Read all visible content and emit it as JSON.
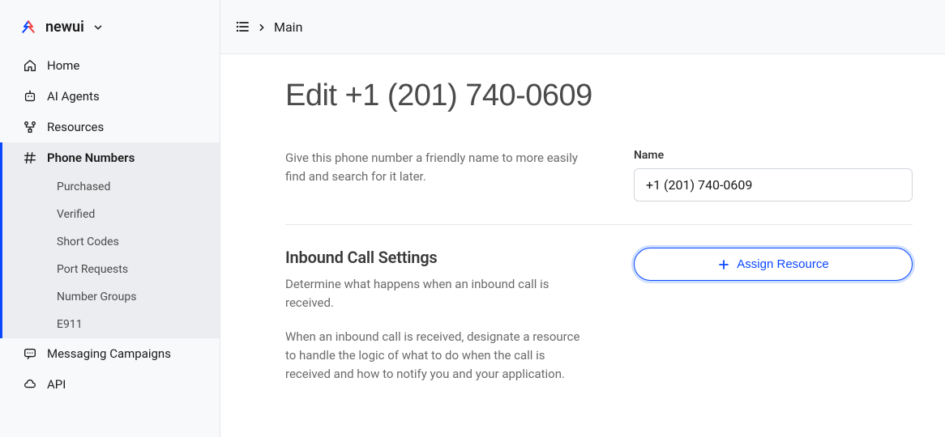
{
  "workspace": {
    "name": "newui"
  },
  "nav": {
    "items": [
      {
        "label": "Home",
        "icon": "home"
      },
      {
        "label": "AI Agents",
        "icon": "robot"
      },
      {
        "label": "Resources",
        "icon": "flow"
      },
      {
        "label": "Phone Numbers",
        "icon": "hash",
        "active": true,
        "children": [
          {
            "label": "Purchased"
          },
          {
            "label": "Verified"
          },
          {
            "label": "Short Codes"
          },
          {
            "label": "Port Requests"
          },
          {
            "label": "Number Groups"
          },
          {
            "label": "E911"
          }
        ]
      },
      {
        "label": "Messaging Campaigns",
        "icon": "message"
      },
      {
        "label": "API",
        "icon": "cloud"
      }
    ]
  },
  "breadcrumb": {
    "label": "Main"
  },
  "page": {
    "title": "Edit +1 (201) 740-0609"
  },
  "name_section": {
    "desc": "Give this phone number a friendly name to more easily find and search for it later.",
    "label": "Name",
    "value": "+1 (201) 740-0609"
  },
  "inbound_section": {
    "title": "Inbound Call Settings",
    "desc1": "Determine what happens when an inbound call is received.",
    "desc2": "When an inbound call is received, designate a resource to handle the logic of what to do when the call is received and how to notify you and your application.",
    "button": "Assign Resource"
  }
}
